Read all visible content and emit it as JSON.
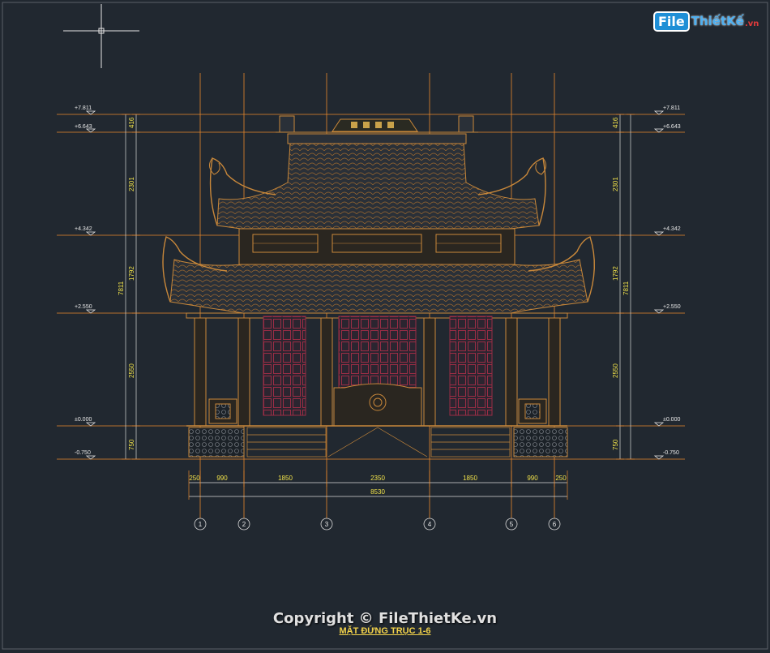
{
  "logo": {
    "brand": "File",
    "name": "ThiếtKế",
    "ext": ".vn"
  },
  "copyright": "Copyright © FileThietKe.vn",
  "drawing_title": "MẶT ĐỨNG TRỤC 1-6",
  "levels": [
    "+7.811",
    "+6.643",
    "+4.342",
    "+2.550",
    "±0.000",
    "-0.750"
  ],
  "left_dims": [
    "416",
    "2301",
    "1792",
    "2550",
    "750"
  ],
  "left_total": "7811",
  "right_dims": [
    "416",
    "2301",
    "1792",
    "2550",
    "750"
  ],
  "right_total": "7811",
  "bottom_dims": [
    "250",
    "990",
    "1850",
    "2350",
    "1850",
    "990",
    "250"
  ],
  "bottom_total": "8530",
  "axes": [
    "1",
    "2",
    "3",
    "4",
    "5",
    "6"
  ],
  "colors": {
    "background": "#212830",
    "grid": "#e8872b",
    "structure": "#c9883a",
    "dimension_text": "#f2e34a",
    "door": "#8a2b3a",
    "tile": "#2a3038"
  }
}
